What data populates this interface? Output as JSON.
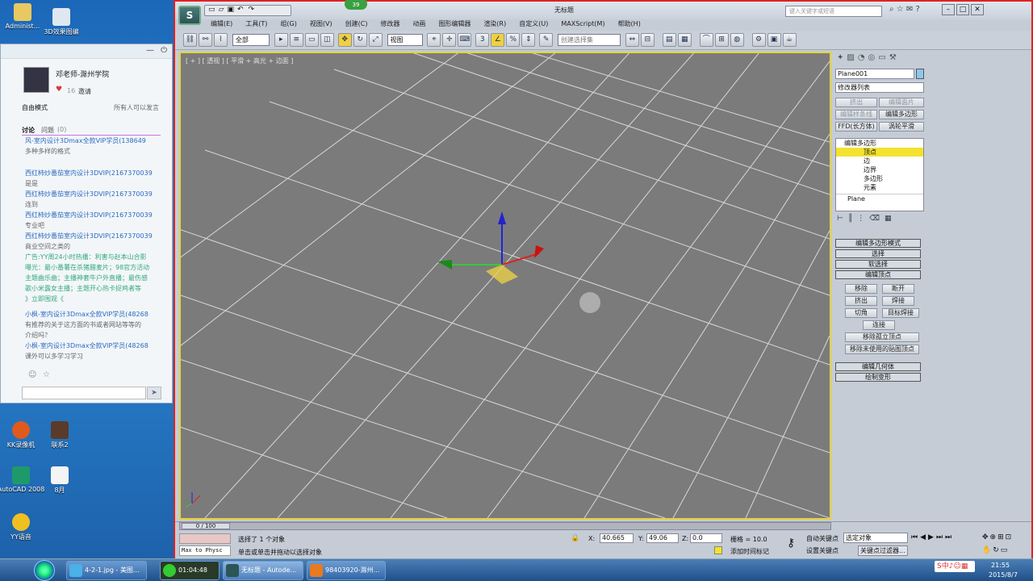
{
  "desktop": {
    "icons": [
      {
        "label": "Administ..."
      },
      {
        "label": "3D效果图编"
      },
      {
        "label": "KK录像机"
      },
      {
        "label": "联系2"
      },
      {
        "label": "AutoCAD 2008"
      },
      {
        "label": "8月"
      },
      {
        "label": "YY语音"
      }
    ]
  },
  "chat": {
    "teacher_name": "邓老师-滁州学院",
    "hearts": "16",
    "invite": "邀请",
    "mode": "自由模式",
    "mode_right": "所有人可以发言",
    "tab_discuss": "讨论",
    "tab_question": "问题",
    "question_count": "(0)",
    "messages": [
      "风-室内设计3Dmax全款VIP学员(138649",
      "多种多样的格式",
      "西红柿炒番茄室内设计3DVIP(2167370039",
      "是是",
      "西红柿炒番茄室内设计3DVIP(2167370039",
      "连到",
      "西红柿炒番茄室内设计3DVIP(2167370039",
      "专业吧",
      "西红柿炒番茄室内设计3DVIP(2167370039",
      "商业空间之类的",
      "广告:YY周24小时热播：利害与赵本山合影",
      "曝光：最小番薯在杀猪腊麦片；98官方活动",
      "主题曲乐曲；主播神套牛户外直播；最伤感",
      "歌小米露女主播；主题开心热卡捉鸡者等",
      "》立即围观《",
      "小枫-室内设计3Dmax全款VIP学员(48268",
      "有推荐的关于这方面的书或者网站等等的",
      "介绍吗？",
      "小枫-室内设计3Dmax全款VIP学员(48268",
      "课外可以多学习学习"
    ]
  },
  "max": {
    "title": "无标题",
    "search_placeholder": "键入关键字或短语",
    "menus": [
      "编辑(E)",
      "工具(T)",
      "组(G)",
      "视图(V)",
      "创建(C)",
      "修改器",
      "动画",
      "图形编辑器",
      "渲染(R)",
      "自定义(U)",
      "MAXScript(M)",
      "帮助(H)"
    ],
    "filter": "全部",
    "coord": "视图",
    "selset": "创建选择集",
    "viewport_label": "[ + ] [ 透视 ] [ 平滑 + 高光 + 边面 ]",
    "panel": {
      "object_name": "Plane001",
      "modifier_list": "修改器列表",
      "btn_extrude": "挤出",
      "btn_edit_patch": "编辑面片",
      "btn_edit_spline": "编辑样条线",
      "btn_edit_poly": "编辑多边形",
      "btn_ffd": "FFD(长方体)",
      "btn_turbo": "涡轮平滑",
      "stack": [
        "编辑多边形",
        "顶点",
        "边",
        "边界",
        "多边形",
        "元素",
        "Plane"
      ],
      "rollouts": [
        "编辑多边形模式",
        "选择",
        "软选择",
        "编辑顶点"
      ],
      "ev_buttons": [
        "移除",
        "断开",
        "挤出",
        "焊接",
        "切角",
        "目标焊接",
        "连接",
        "移除孤立顶点",
        "移除未使用的贴图顶点"
      ],
      "rollouts2": [
        "编辑几何体",
        "绘制变形"
      ]
    },
    "timeline": "0 / 100",
    "status": {
      "selected": "选择了 1 个对象",
      "hint": "单击或单击并拖动以选择对象",
      "script": "Max to Physc",
      "x": "40.665",
      "y": "49.06",
      "z": "0.0",
      "grid": "栅格 = 10.0",
      "autokey": "自动关键点",
      "setkey": "设置关键点",
      "selected_obj": "选定对象",
      "keyfilter": "关键点过滤器...",
      "add_time_tag": "添加时间标记"
    }
  },
  "taskbar": {
    "tasks": [
      "4-2-1.jpg - 美图...",
      "01:04:48",
      "无标题 - Autode...",
      "98403920-滁州..."
    ],
    "time": "21:55",
    "date": "2015/8/7"
  }
}
